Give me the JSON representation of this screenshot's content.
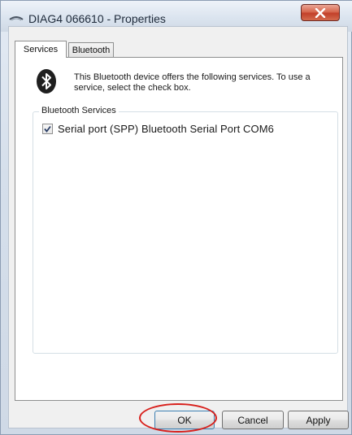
{
  "window": {
    "title": "DIAG4 066610 - Properties",
    "close_symbol": "x"
  },
  "tabs": [
    {
      "label": "Services",
      "selected": true
    },
    {
      "label": "Bluetooth",
      "selected": false
    }
  ],
  "content": {
    "description": "This Bluetooth device offers the following services. To use a service, select the check box.",
    "icon": "bluetooth-icon",
    "group_label": "Bluetooth Services",
    "services": [
      {
        "label": "Serial port (SPP) Bluetooth Serial Port  COM6",
        "checked": true
      }
    ]
  },
  "buttons": {
    "ok": "OK",
    "cancel": "Cancel",
    "apply": "Apply"
  },
  "colors": {
    "highlight": "#d8201c",
    "bluetooth_badge": "#1f1f1f"
  }
}
